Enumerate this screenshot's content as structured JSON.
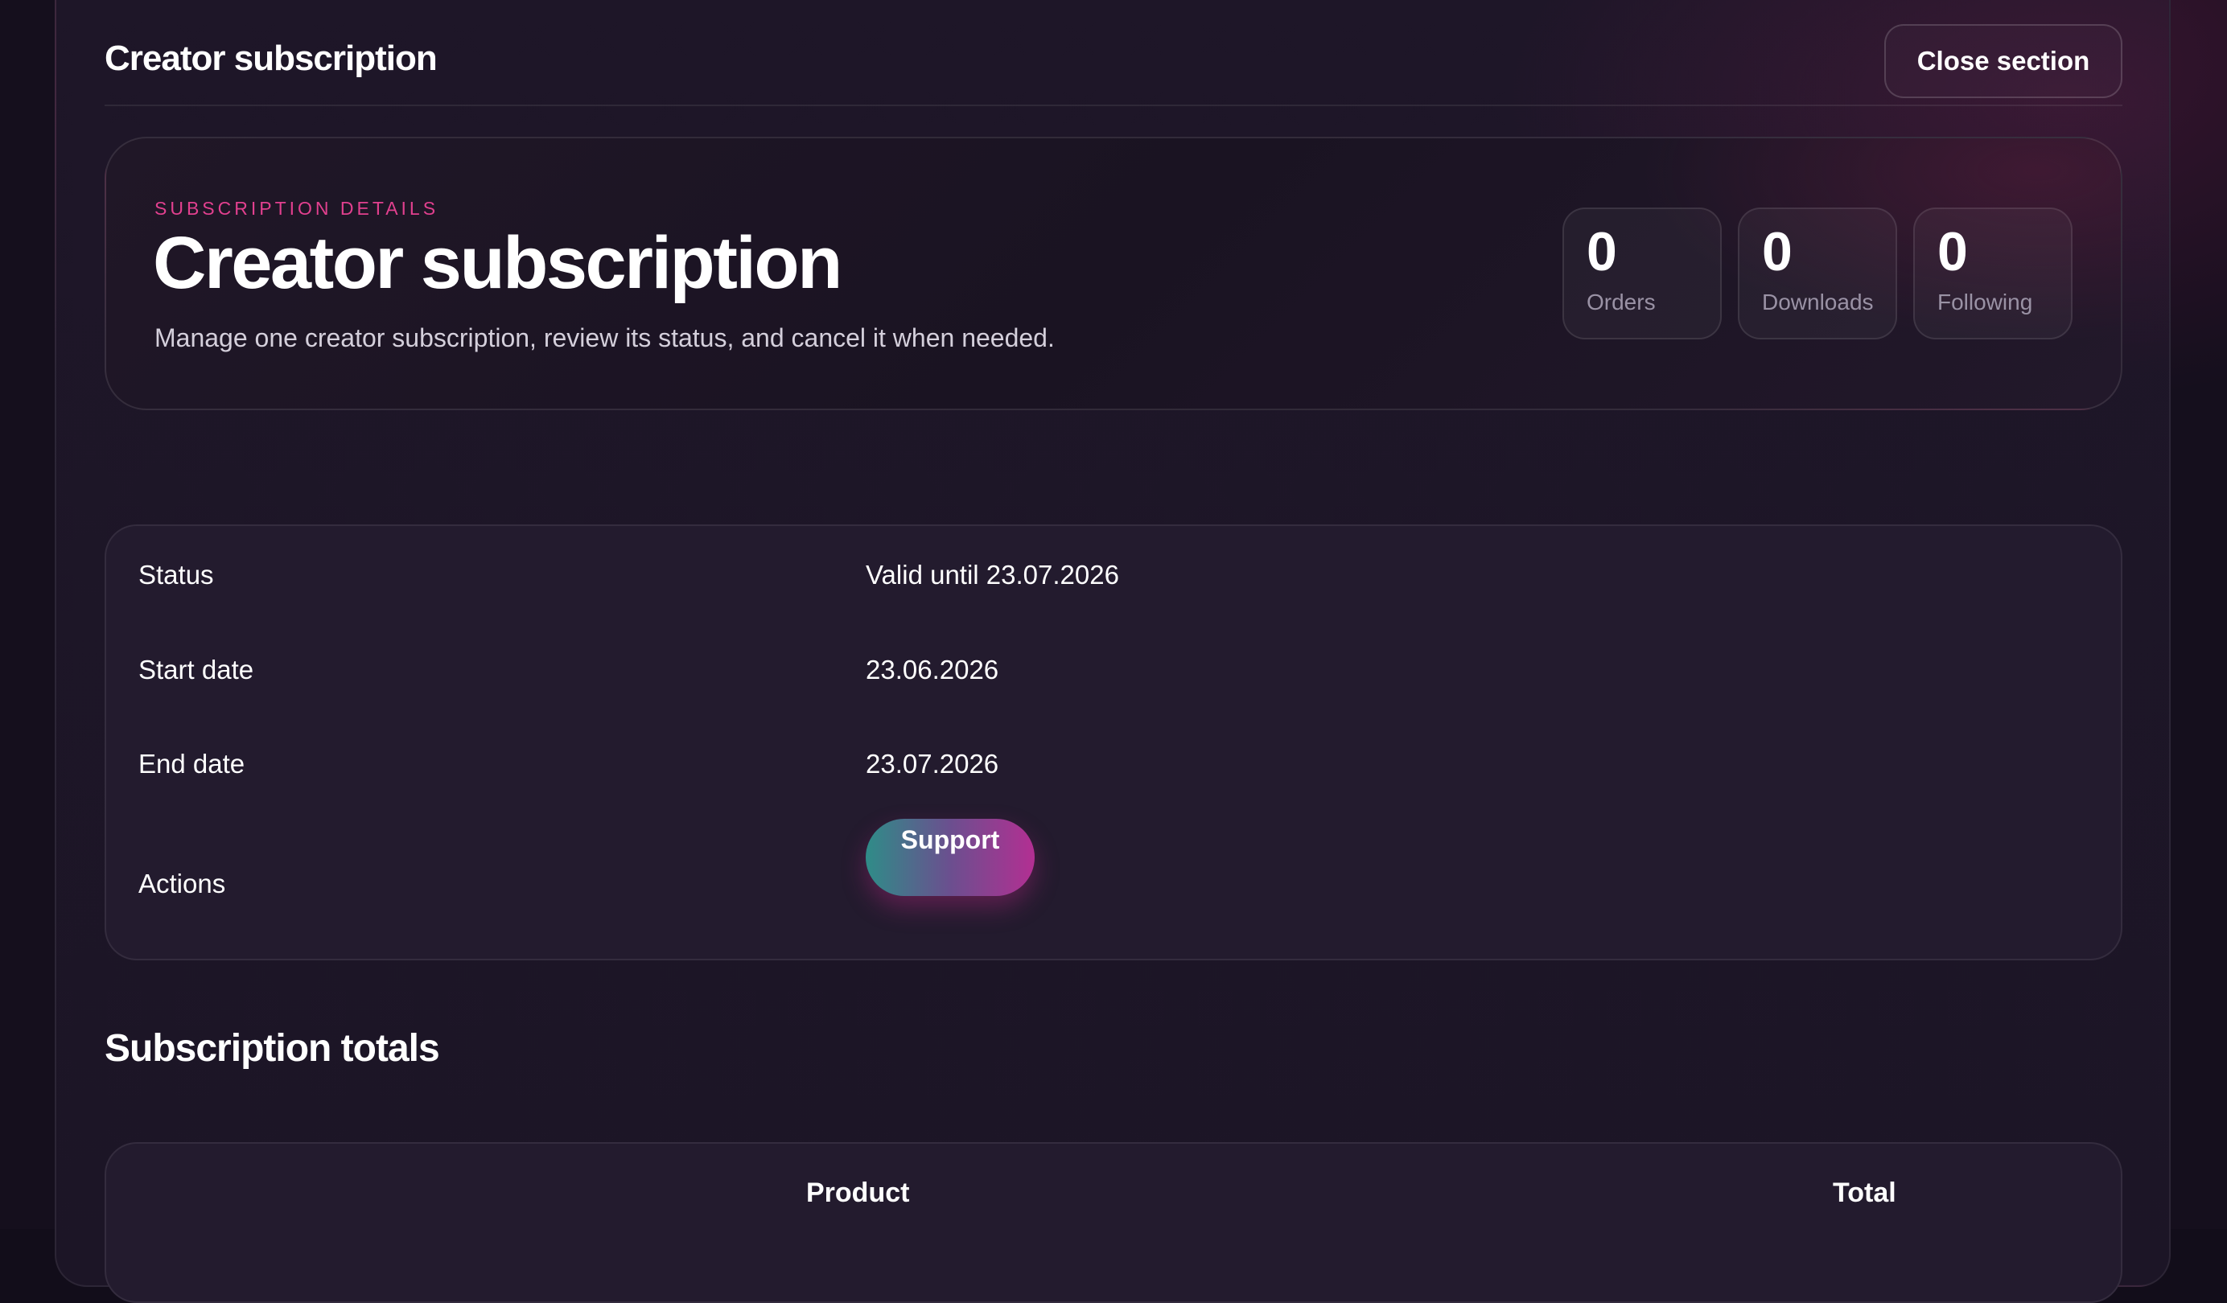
{
  "header": {
    "title": "Creator subscription",
    "close_label": "Close section"
  },
  "hero": {
    "eyebrow": "SUBSCRIPTION DETAILS",
    "title": "Creator subscription",
    "description": "Manage one creator subscription, review its status, and cancel it when needed.",
    "stats": [
      {
        "value": "0",
        "label": "Orders"
      },
      {
        "value": "0",
        "label": "Downloads"
      },
      {
        "value": "0",
        "label": "Following"
      }
    ]
  },
  "details": {
    "rows": [
      {
        "label": "Status",
        "value": "Valid until 23.07.2026"
      },
      {
        "label": "Start date",
        "value": "23.06.2026"
      },
      {
        "label": "End date",
        "value": "23.07.2026"
      },
      {
        "label": "Actions",
        "value": ""
      }
    ],
    "support_label": "Support"
  },
  "totals": {
    "title": "Subscription totals",
    "columns": [
      "Product",
      "Total"
    ]
  },
  "colors": {
    "accent_pink": "#e2408f",
    "button_gradient_start": "#2f8c88",
    "button_gradient_end": "#b32f92",
    "background": "#150f1d"
  }
}
